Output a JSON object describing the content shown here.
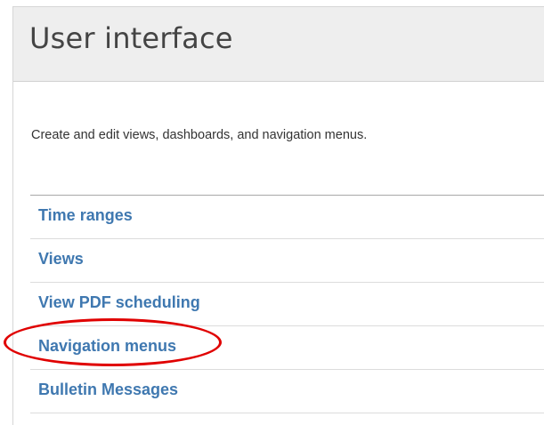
{
  "header": {
    "title": "User interface"
  },
  "description": "Create and edit views, dashboards, and navigation menus.",
  "links": [
    {
      "label": "Time ranges"
    },
    {
      "label": "Views"
    },
    {
      "label": "View PDF scheduling"
    },
    {
      "label": "Navigation menus",
      "highlighted": true
    },
    {
      "label": "Bulletin Messages"
    }
  ],
  "colors": {
    "link": "#3f78b0",
    "highlight": "#e00000",
    "header_bg": "#eeeeee"
  }
}
